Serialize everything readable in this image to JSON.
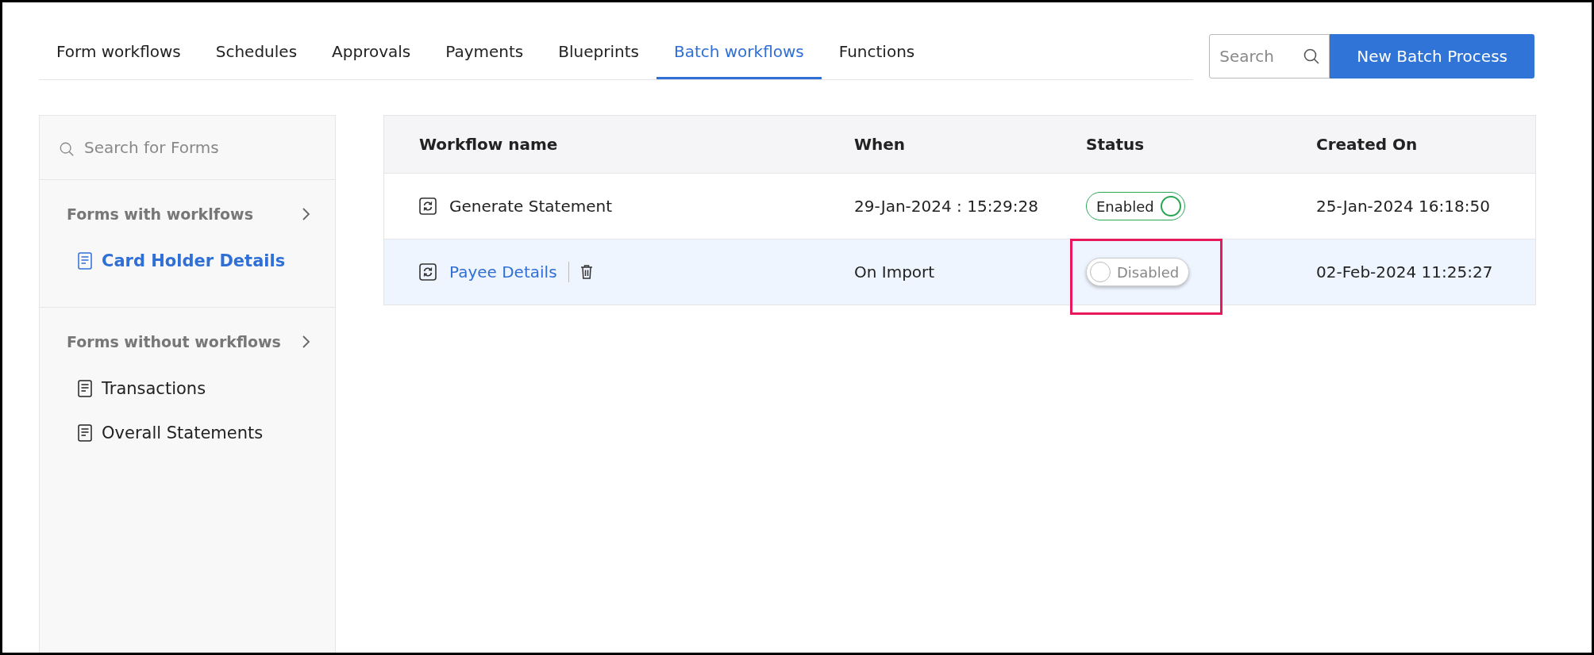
{
  "tabs": [
    {
      "label": "Form workflows",
      "selected": false
    },
    {
      "label": "Schedules",
      "selected": false
    },
    {
      "label": "Approvals",
      "selected": false
    },
    {
      "label": "Payments",
      "selected": false
    },
    {
      "label": "Blueprints",
      "selected": false
    },
    {
      "label": "Batch workflows",
      "selected": true
    },
    {
      "label": "Functions",
      "selected": false
    }
  ],
  "search": {
    "placeholder": "Search"
  },
  "new_button": "New Batch Process",
  "sidebar": {
    "search": {
      "placeholder": "Search for Forms"
    },
    "sections": [
      {
        "title": "Forms with worklfows",
        "items": [
          {
            "label": "Card Holder Details",
            "selected": true
          }
        ]
      },
      {
        "title": "Forms without workflows",
        "items": [
          {
            "label": "Transactions",
            "selected": false
          },
          {
            "label": "Overall Statements",
            "selected": false
          }
        ]
      }
    ]
  },
  "table": {
    "columns": [
      "Workflow name",
      "When",
      "Status",
      "Created On"
    ],
    "rows": [
      {
        "name": "Generate Statement",
        "when": "29-Jan-2024 : 15:29:28",
        "status": "Enabled",
        "enabled": true,
        "created": "25-Jan-2024 16:18:50",
        "selected": false,
        "highlighted": false
      },
      {
        "name": "Payee Details",
        "when": "On Import",
        "status": "Disabled",
        "enabled": false,
        "created": "02-Feb-2024 11:25:27",
        "selected": true,
        "highlighted": true
      }
    ]
  }
}
